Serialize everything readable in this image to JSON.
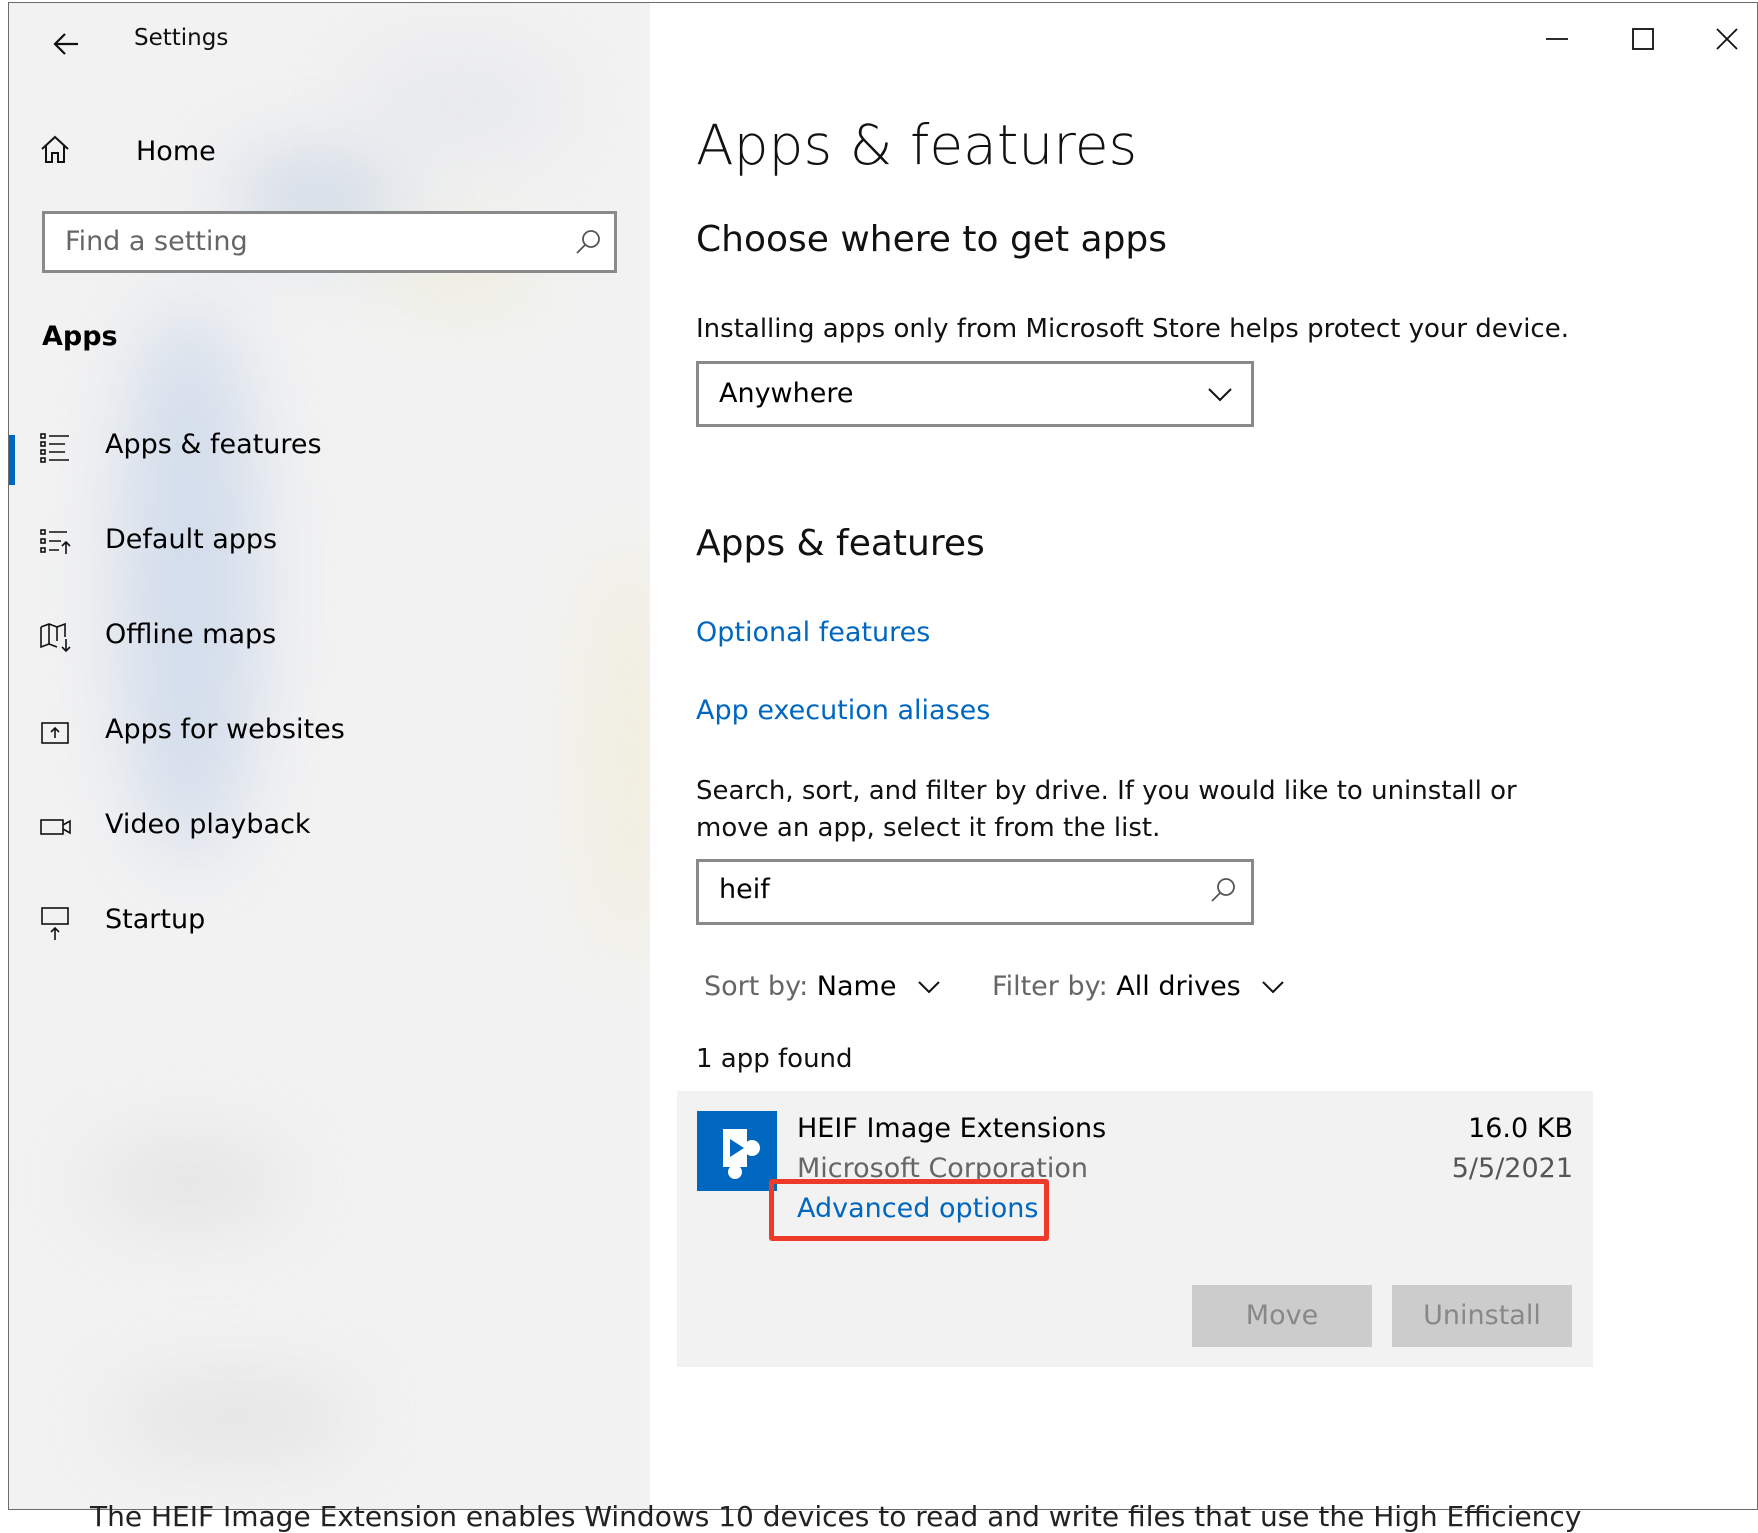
{
  "window": {
    "title": "Settings"
  },
  "sidebar": {
    "home_label": "Home",
    "search_placeholder": "Find a setting",
    "section_title": "Apps",
    "items": [
      {
        "label": "Apps & features",
        "icon": "list-icon",
        "selected": true
      },
      {
        "label": "Default apps",
        "icon": "default-apps-icon",
        "selected": false
      },
      {
        "label": "Offline maps",
        "icon": "map-download-icon",
        "selected": false
      },
      {
        "label": "Apps for websites",
        "icon": "open-external-icon",
        "selected": false
      },
      {
        "label": "Video playback",
        "icon": "video-icon",
        "selected": false
      },
      {
        "label": "Startup",
        "icon": "startup-icon",
        "selected": false
      }
    ]
  },
  "main": {
    "title": "Apps & features",
    "choose_heading": "Choose where to get apps",
    "choose_desc": "Installing apps only from Microsoft Store helps protect your device.",
    "source_value": "Anywhere",
    "features_heading": "Apps & features",
    "optional_features_link": "Optional features",
    "aliases_link": "App execution aliases",
    "search_desc": "Search, sort, and filter by drive. If you would like to uninstall or move an app, select it from the list.",
    "search_value": "heif",
    "sort_label": "Sort by:",
    "sort_value": "Name",
    "filter_label": "Filter by:",
    "filter_value": "All drives",
    "result_count": "1 app found",
    "app": {
      "name": "HEIF Image Extensions",
      "publisher": "Microsoft Corporation",
      "advanced_link": "Advanced options",
      "size": "16.0 KB",
      "date": "5/5/2021",
      "move_label": "Move",
      "uninstall_label": "Uninstall"
    }
  },
  "underlying_text": "The HEIF Image Extension enables Windows 10 devices to read and write files that use the High Efficiency",
  "colors": {
    "accent": "#0067c0",
    "highlight_mark": "#ee3a28",
    "disabled_button": "#cccccc"
  }
}
